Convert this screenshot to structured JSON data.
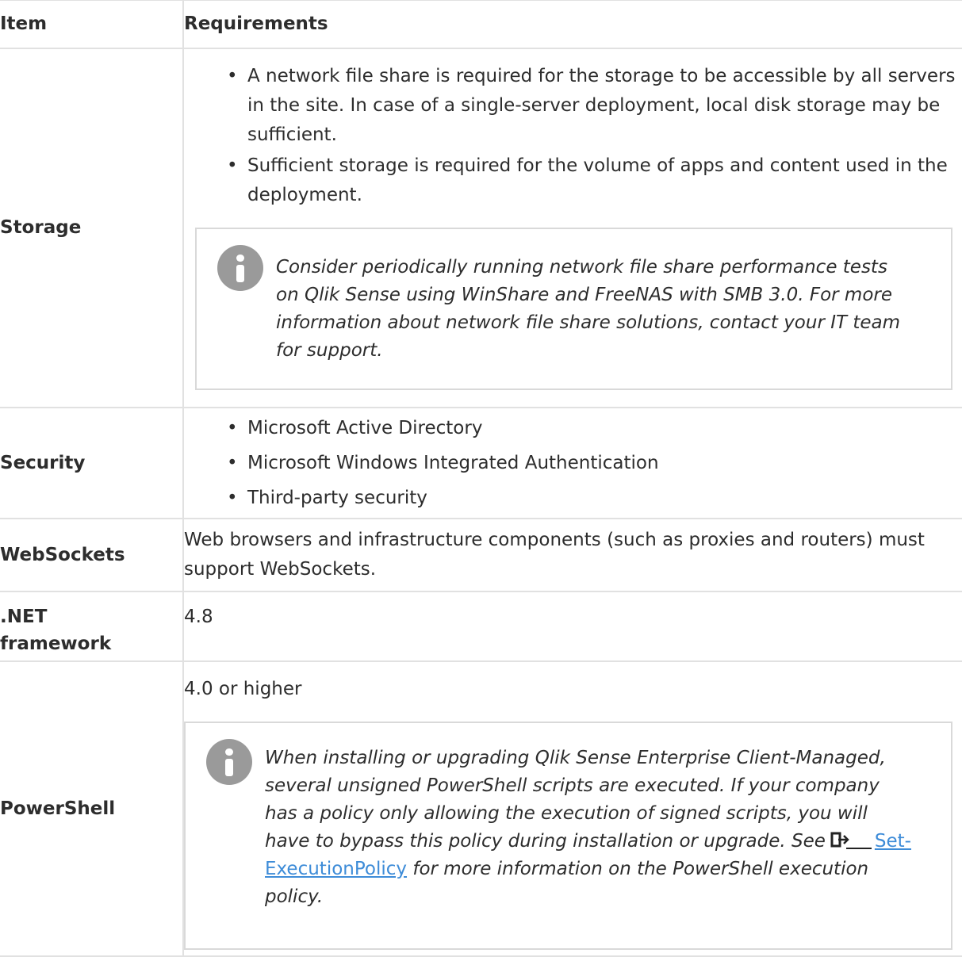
{
  "table": {
    "headers": {
      "item": "Item",
      "requirements": "Requirements"
    },
    "storage": {
      "item": "Storage",
      "bullets": [
        "A network file share is required for the storage to be accessible by all servers in the site. In case of a single-server deployment, local disk storage may be sufficient.",
        "Sufficient storage is required for the volume of apps and content used in the deployment."
      ],
      "note": "Consider periodically running network file share performance tests on Qlik Sense using WinShare and FreeNAS with SMB 3.0. For more information about network file share solutions, contact your IT team for support."
    },
    "security": {
      "item": "Security",
      "bullets": [
        "Microsoft Active Directory",
        "Microsoft Windows Integrated Authentication",
        "Third-party security"
      ]
    },
    "websockets": {
      "item": "WebSockets",
      "text": "Web browsers and infrastructure components (such as proxies and routers) must support WebSockets."
    },
    "dotnet": {
      "item": ".NET framework",
      "text": "4.8"
    },
    "powershell": {
      "item": "PowerShell",
      "text": "4.0 or higher",
      "note_before_link": "When installing or upgrading Qlik Sense Enterprise Client-Managed, several unsigned PowerShell scripts are executed. If your company has a policy only allowing the execution of signed scripts, you will have to bypass this policy during installation or upgrade. See",
      "link_text": "Set-ExecutionPolicy",
      "note_after_link": " for more information on the PowerShell execution policy."
    }
  },
  "icons": {
    "info": "info-icon",
    "external_link": "external-link-icon"
  },
  "colors": {
    "link": "#3e8cd8",
    "info_icon": "#9a9a9a",
    "border": "#e1e1e1"
  }
}
